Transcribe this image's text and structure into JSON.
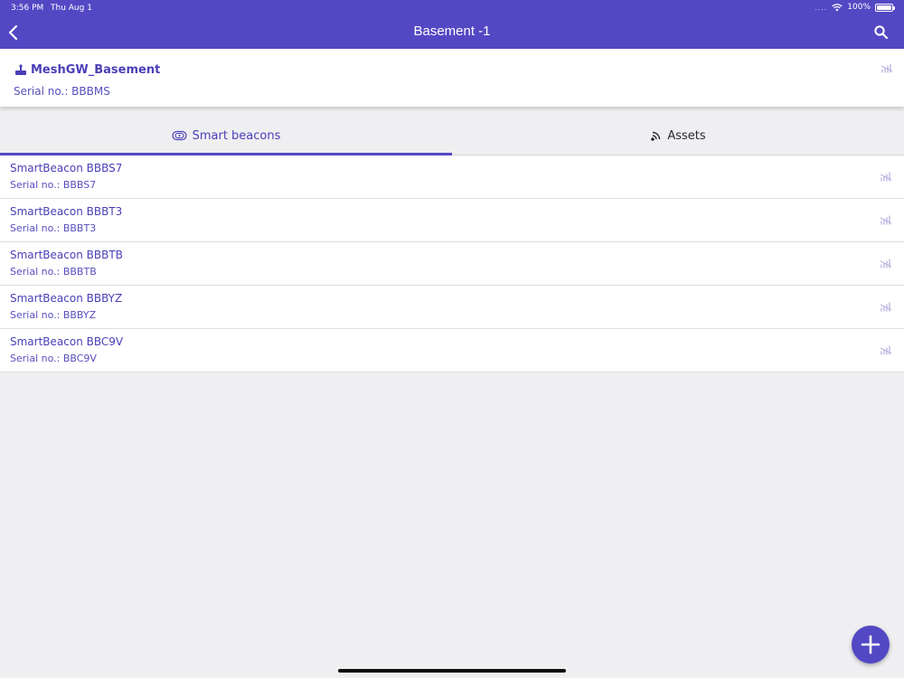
{
  "status_bar": {
    "time": "3:56 PM",
    "date": "Thu Aug 1",
    "signal_dots": "....",
    "battery": "100%"
  },
  "header": {
    "title": "Basement -1",
    "back_icon": "chevron-left-icon",
    "search_icon": "search-icon",
    "background": "#5348c4"
  },
  "gateway": {
    "name": "MeshGW_Basement",
    "serial": "Serial no.: BBBMS",
    "icon": "gateway-icon"
  },
  "tabs": [
    {
      "label": "Smart beacons",
      "icon": "beacon-icon",
      "selected": true
    },
    {
      "label": "Assets",
      "icon": "asset-signal-icon",
      "selected": false
    }
  ],
  "beacons": [
    {
      "name": "SmartBeacon BBBS7",
      "serial": "Serial no.: BBBS7"
    },
    {
      "name": "SmartBeacon BBBT3",
      "serial": "Serial no.: BBBT3"
    },
    {
      "name": "SmartBeacon BBBTB",
      "serial": "Serial no.: BBBTB"
    },
    {
      "name": "SmartBeacon BBBYZ",
      "serial": "Serial no.: BBBYZ"
    },
    {
      "name": "SmartBeacon BBC9V",
      "serial": "Serial no.: BBC9V"
    }
  ],
  "fab": {
    "icon": "plus-icon"
  },
  "colors": {
    "accent": "#5348c4",
    "text_accent": "#4a3fb8",
    "background": "#efeff1"
  }
}
